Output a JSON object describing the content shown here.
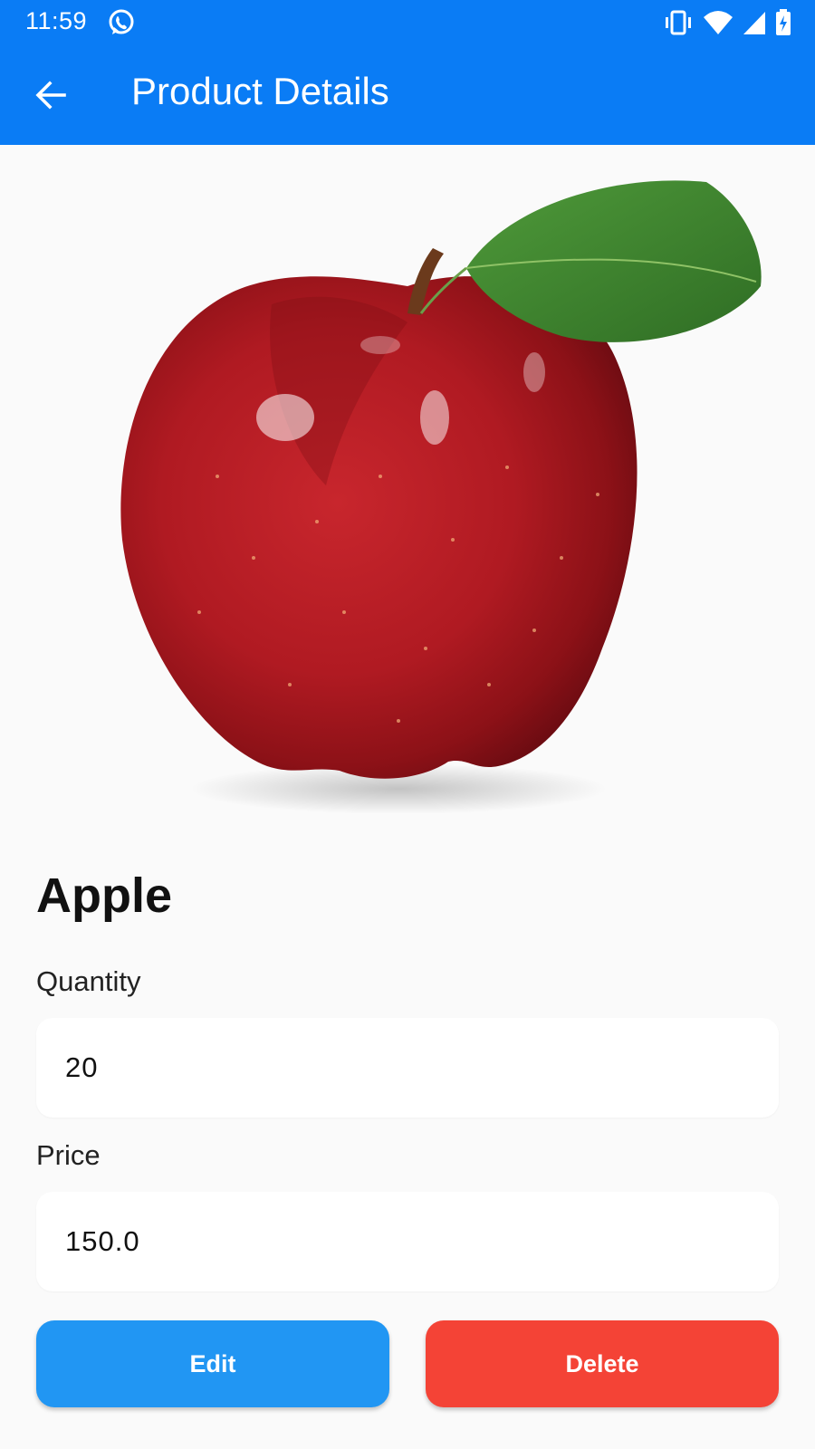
{
  "status_bar": {
    "time": "11:59",
    "icons": [
      "whatsapp-icon",
      "vibrate-icon",
      "wifi-icon",
      "signal-icon",
      "battery-charging-icon"
    ]
  },
  "app_bar": {
    "title": "Product Details",
    "back_icon": "arrow-back-icon",
    "color": "#0a7cf5"
  },
  "product": {
    "image": "red-apple-with-leaf",
    "name": "Apple",
    "quantity_label": "Quantity",
    "quantity_value": "20",
    "price_label": "Price",
    "price_value": "150.0"
  },
  "actions": {
    "edit_label": "Edit",
    "edit_color": "#2196f3",
    "delete_label": "Delete",
    "delete_color": "#f44336"
  }
}
